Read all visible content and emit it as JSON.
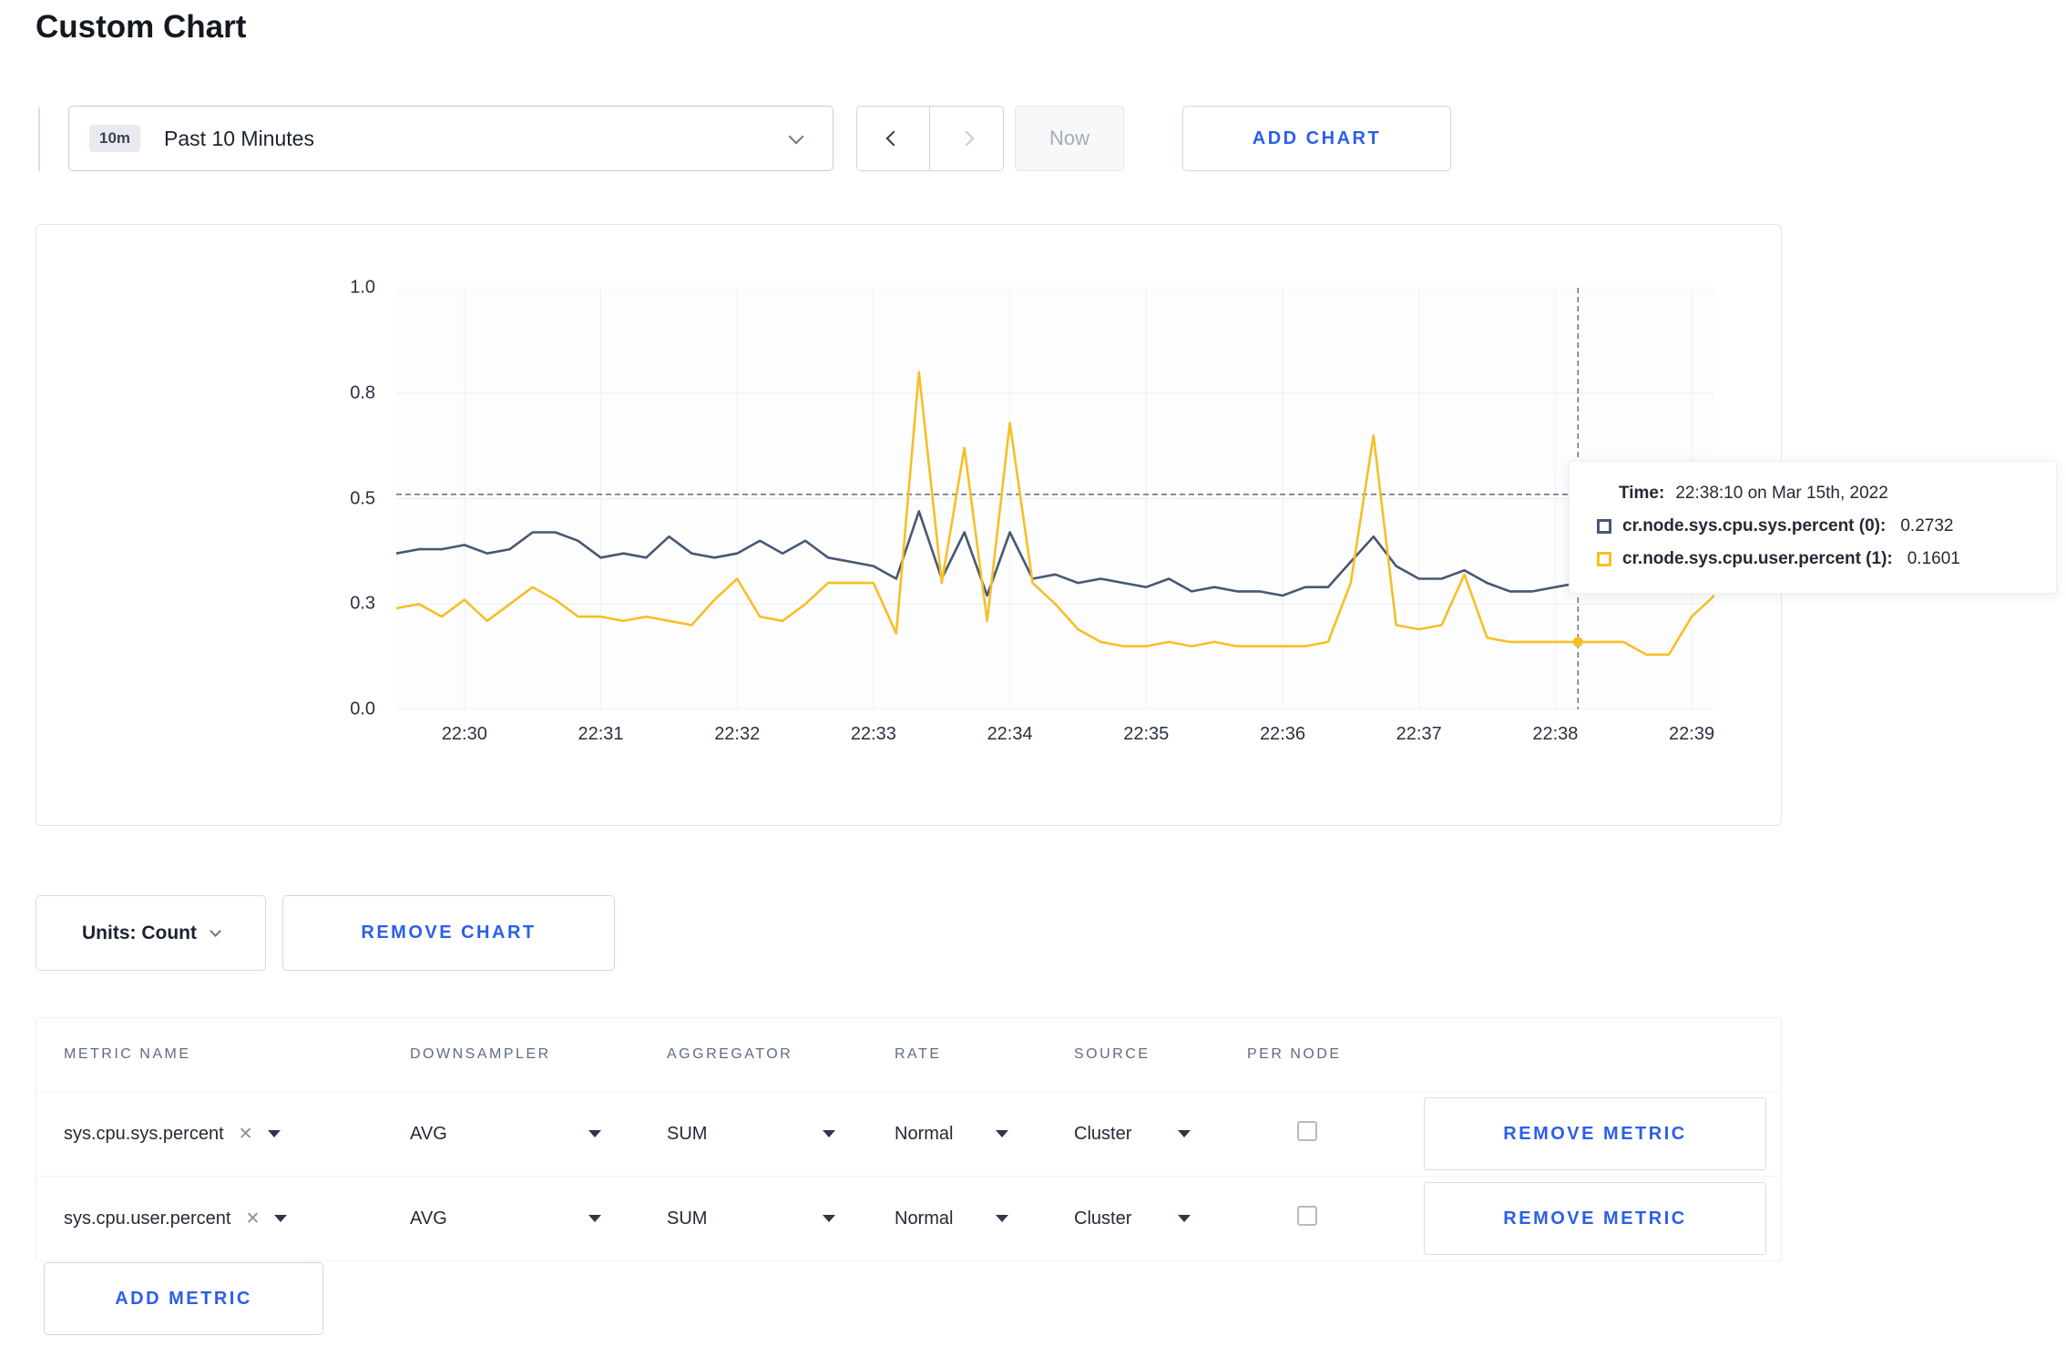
{
  "page": {
    "title": "Custom Chart"
  },
  "colors": {
    "accent_blue": "#2b5fe8",
    "series_sys": "#475872",
    "series_user": "#f6bf26"
  },
  "icons": {
    "clear": "✕"
  },
  "toolbar": {
    "time_badge": "10m",
    "time_label": "Past 10 Minutes",
    "now_label": "Now",
    "add_chart_label": "ADD CHART"
  },
  "chart": {
    "tooltip": {
      "time_label": "Time:",
      "time_value": "22:38:10 on Mar 15th, 2022",
      "rows": [
        {
          "name": "cr.node.sys.cpu.sys.percent (0):",
          "value": "0.2732"
        },
        {
          "name": "cr.node.sys.cpu.user.percent (1):",
          "value": "0.1601"
        }
      ]
    }
  },
  "chart_data": {
    "type": "line",
    "title": "",
    "x_unit": "seconds after 22:29:30",
    "x_range": [
      0,
      580
    ],
    "y_range": [
      0,
      1
    ],
    "grid": true,
    "legend_position": "tooltip",
    "guide_y": 0.51,
    "crosshair_x": 520,
    "y_ticks": [
      {
        "value": 0,
        "label": "0.0"
      },
      {
        "value": 0.25,
        "label": "0.3"
      },
      {
        "value": 0.5,
        "label": "0.5"
      },
      {
        "value": 0.75,
        "label": "0.8"
      },
      {
        "value": 1,
        "label": "1.0"
      }
    ],
    "x_ticks": [
      {
        "t": 30,
        "label": "22:30"
      },
      {
        "t": 90,
        "label": "22:31"
      },
      {
        "t": 150,
        "label": "22:32"
      },
      {
        "t": 210,
        "label": "22:33"
      },
      {
        "t": 270,
        "label": "22:34"
      },
      {
        "t": 330,
        "label": "22:35"
      },
      {
        "t": 390,
        "label": "22:36"
      },
      {
        "t": 450,
        "label": "22:37"
      },
      {
        "t": 510,
        "label": "22:38"
      },
      {
        "t": 570,
        "label": "22:39"
      }
    ],
    "x": [
      0,
      10,
      20,
      30,
      40,
      50,
      60,
      70,
      80,
      90,
      100,
      110,
      120,
      130,
      140,
      150,
      160,
      170,
      180,
      190,
      200,
      210,
      220,
      230,
      240,
      250,
      260,
      270,
      280,
      290,
      300,
      310,
      320,
      330,
      340,
      350,
      360,
      370,
      380,
      390,
      400,
      410,
      420,
      430,
      440,
      450,
      460,
      470,
      480,
      490,
      500,
      510,
      520,
      530,
      540,
      550,
      560,
      570,
      580
    ],
    "series": [
      {
        "name": "cr.node.sys.cpu.sys.percent",
        "color": "#475872",
        "values": [
          0.37,
          0.38,
          0.38,
          0.39,
          0.37,
          0.38,
          0.42,
          0.42,
          0.4,
          0.36,
          0.37,
          0.36,
          0.41,
          0.37,
          0.36,
          0.37,
          0.4,
          0.37,
          0.4,
          0.36,
          0.35,
          0.34,
          0.31,
          0.47,
          0.31,
          0.42,
          0.27,
          0.42,
          0.31,
          0.32,
          0.3,
          0.31,
          0.3,
          0.29,
          0.31,
          0.28,
          0.29,
          0.28,
          0.28,
          0.27,
          0.29,
          0.29,
          0.35,
          0.41,
          0.34,
          0.31,
          0.31,
          0.33,
          0.3,
          0.28,
          0.28,
          0.29,
          0.3,
          0.3,
          0.31,
          0.3,
          0.3,
          0.3,
          0.31
        ]
      },
      {
        "name": "cr.node.sys.cpu.user.percent",
        "color": "#f6bf26",
        "values": [
          0.24,
          0.25,
          0.22,
          0.26,
          0.21,
          0.25,
          0.29,
          0.26,
          0.22,
          0.22,
          0.21,
          0.22,
          0.21,
          0.2,
          0.26,
          0.31,
          0.22,
          0.21,
          0.25,
          0.3,
          0.3,
          0.3,
          0.18,
          0.8,
          0.3,
          0.62,
          0.21,
          0.68,
          0.3,
          0.25,
          0.19,
          0.16,
          0.15,
          0.15,
          0.16,
          0.15,
          0.16,
          0.15,
          0.15,
          0.15,
          0.15,
          0.16,
          0.3,
          0.65,
          0.2,
          0.19,
          0.2,
          0.32,
          0.17,
          0.16,
          0.16,
          0.16,
          0.16,
          0.16,
          0.16,
          0.13,
          0.13,
          0.22,
          0.27
        ]
      }
    ]
  },
  "controls": {
    "units_label": "Units: Count",
    "remove_chart_label": "REMOVE CHART",
    "add_metric_label": "ADD METRIC"
  },
  "table": {
    "headers": [
      "METRIC NAME",
      "DOWNSAMPLER",
      "AGGREGATOR",
      "RATE",
      "SOURCE",
      "PER NODE"
    ],
    "rows": [
      {
        "metric": "sys.cpu.sys.percent",
        "downsampler": "AVG",
        "aggregator": "SUM",
        "rate": "Normal",
        "source": "Cluster",
        "per_node_checked": false,
        "remove_label": "REMOVE METRIC"
      },
      {
        "metric": "sys.cpu.user.percent",
        "downsampler": "AVG",
        "aggregator": "SUM",
        "rate": "Normal",
        "source": "Cluster",
        "per_node_checked": false,
        "remove_label": "REMOVE METRIC"
      }
    ]
  }
}
